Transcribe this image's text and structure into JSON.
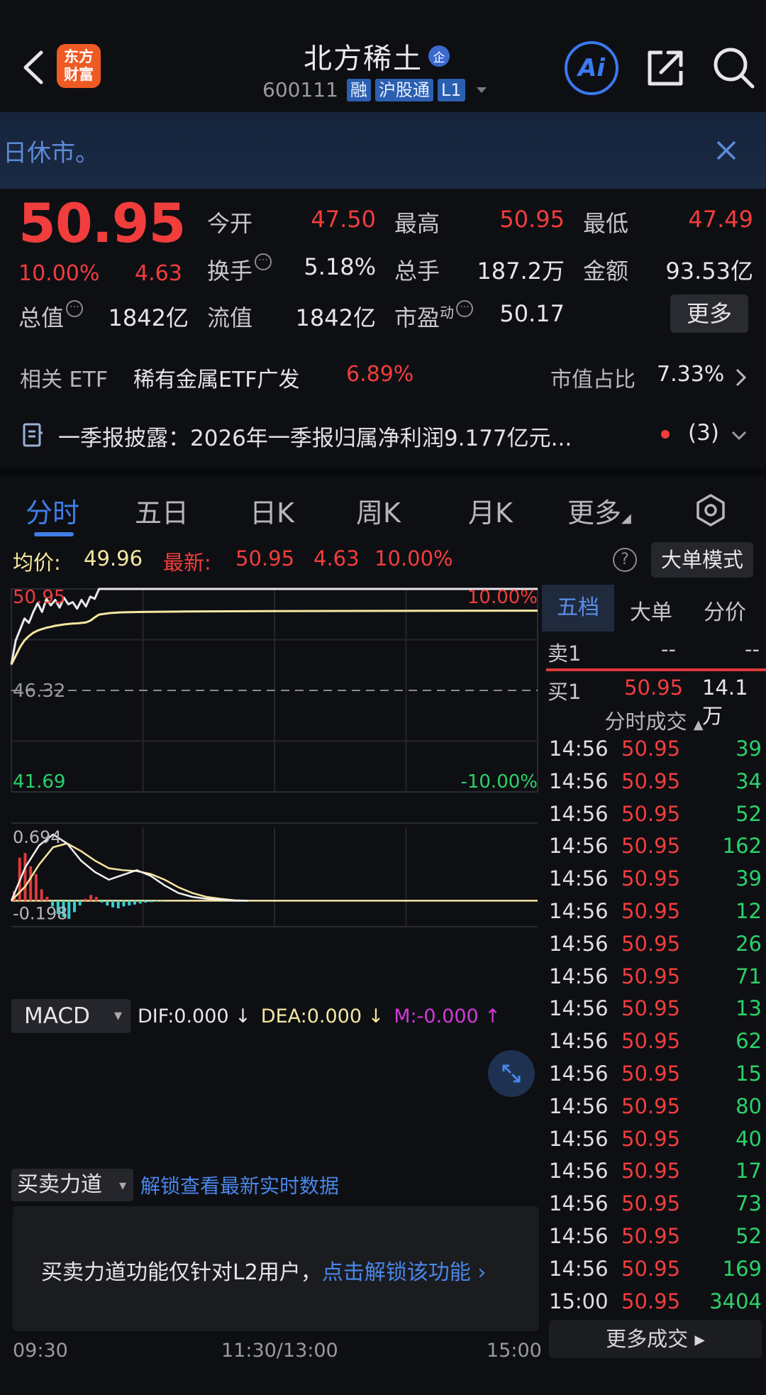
{
  "header": {
    "title": "北方稀土",
    "title_badge": "企",
    "logo_text_1": "东方",
    "logo_text_2": "财富",
    "code": "600111",
    "tags": [
      "融",
      "沪股通",
      "L1"
    ],
    "ai_label": "Ai",
    "icons": [
      "back-icon",
      "share-icon",
      "search-icon"
    ]
  },
  "notice": {
    "text": "日休市。"
  },
  "quote": {
    "price": "50.95",
    "pct": "10.00%",
    "change": "4.63",
    "stats": [
      {
        "label": "今开",
        "value": "47.50",
        "color": "#f23d3d"
      },
      {
        "label": "最高",
        "value": "50.95",
        "color": "#f23d3d"
      },
      {
        "label": "最低",
        "value": "47.49",
        "color": "#f23d3d"
      },
      {
        "label": "换手",
        "value": "5.18%",
        "color": "#e6e6ea"
      },
      {
        "label": "总手",
        "value": "187.2万",
        "color": "#e6e6ea"
      },
      {
        "label": "金额",
        "value": "93.53亿",
        "color": "#e6e6ea"
      },
      {
        "label": "总值",
        "value": "1842亿",
        "color": "#e6e6ea"
      },
      {
        "label": "流值",
        "value": "1842亿",
        "color": "#e6e6ea"
      },
      {
        "label": "市盈",
        "value": "50.17",
        "color": "#e6e6ea"
      }
    ],
    "pe_sup": "动",
    "more_label": "更多"
  },
  "etf": {
    "label": "相关 ETF",
    "name": "稀有金属ETF广发",
    "pct": "6.89%",
    "share_label": "市值占比",
    "share_value": "7.33%"
  },
  "report": {
    "text": "一季报披露：2026年一季报归属净利润9.177亿元...",
    "count": "(3)"
  },
  "tabs": [
    "分时",
    "五日",
    "日K",
    "周K",
    "月K",
    "更多"
  ],
  "avg_row": {
    "avg_label": "均价:",
    "avg_value": "49.96",
    "latest_label": "最新:",
    "latest_value": "50.95",
    "latest_change": "4.63",
    "latest_pct": "10.00%",
    "help": "?",
    "bigmode_label": "大单模式"
  },
  "chart_data": {
    "type": "line",
    "price_axis": {
      "top": "50.95",
      "mid": "46.32",
      "bottom": "41.69",
      "top_pct": "10.00%",
      "bottom_pct": "-10.00%"
    },
    "price_range": [
      41.69,
      50.95
    ],
    "prev_close": 46.32,
    "time_labels": [
      "09:30",
      "11:30/13:00",
      "15:00"
    ],
    "x_minutes": [
      0,
      2,
      4,
      6,
      8,
      10,
      12,
      14,
      16,
      18,
      20,
      22,
      24,
      26,
      28,
      30,
      32,
      34,
      36,
      38,
      40,
      45,
      50,
      60,
      80,
      120,
      180,
      240
    ],
    "series": [
      {
        "values": [
          47.5,
          48.6,
          49.1,
          49.6,
          49.4,
          49.9,
          50.3,
          49.9,
          50.5,
          50.2,
          50.45,
          50.1,
          50.55,
          50.25,
          50.35,
          50.05,
          50.45,
          50.15,
          50.6,
          50.5,
          50.95,
          50.95,
          50.95,
          50.95,
          50.95,
          50.95,
          50.95,
          50.95
        ],
        "color": "#e8e8ec"
      },
      {
        "values": [
          47.5,
          47.9,
          48.3,
          48.6,
          48.8,
          48.95,
          49.05,
          49.12,
          49.18,
          49.22,
          49.27,
          49.3,
          49.33,
          49.35,
          49.37,
          49.38,
          49.4,
          49.42,
          49.5,
          49.65,
          49.78,
          49.85,
          49.88,
          49.9,
          49.92,
          49.94,
          49.95,
          49.96
        ],
        "color": "#f5e7a0"
      }
    ],
    "macd": {
      "label": "MACD",
      "dif_label": "DIF:0.000 ↓",
      "dea_label": "DEA:0.000 ↓",
      "m_label": "M:-0.000 ↑",
      "y_top": "0.694",
      "y_bottom": "-0.198",
      "ylim": [
        -0.198,
        0.694
      ],
      "dif": [
        0.0,
        0.35,
        0.58,
        0.694,
        0.6,
        0.42,
        0.3,
        0.22,
        0.27,
        0.32,
        0.26,
        0.16,
        0.08,
        0.04,
        0.02,
        0.01,
        0.0,
        0.0
      ],
      "dea": [
        0.0,
        0.15,
        0.38,
        0.56,
        0.6,
        0.52,
        0.42,
        0.34,
        0.32,
        0.31,
        0.28,
        0.22,
        0.14,
        0.08,
        0.04,
        0.02,
        0.005,
        0.0
      ],
      "hist": [
        0.1,
        0.45,
        0.5,
        0.36,
        0.28,
        0.12,
        0.04,
        -0.06,
        -0.14,
        -0.17,
        -0.19,
        -0.12,
        -0.05,
        0.02,
        0.06,
        0.04,
        -0.02,
        -0.05,
        -0.07,
        -0.08,
        -0.06,
        -0.05,
        -0.04,
        -0.03,
        -0.02,
        -0.015,
        -0.01,
        -0.005,
        0.0
      ]
    }
  },
  "force": {
    "select_label": "买卖力道",
    "unlock_link": "解锁查看最新实时数据",
    "panel_text": "买卖力道功能仅针对L2用户，",
    "panel_link": "点击解锁该功能"
  },
  "orderbook": {
    "tabs": [
      "五档",
      "大单",
      "分价"
    ],
    "sell1": {
      "label": "卖1",
      "price": "--",
      "vol": "--"
    },
    "buy1": {
      "label": "买1",
      "price": "50.95",
      "vol": "14.1万"
    },
    "trades_head": "分时成交",
    "trades": [
      {
        "t": "14:56",
        "p": "50.95",
        "v": "39"
      },
      {
        "t": "14:56",
        "p": "50.95",
        "v": "34"
      },
      {
        "t": "14:56",
        "p": "50.95",
        "v": "52"
      },
      {
        "t": "14:56",
        "p": "50.95",
        "v": "162"
      },
      {
        "t": "14:56",
        "p": "50.95",
        "v": "39"
      },
      {
        "t": "14:56",
        "p": "50.95",
        "v": "12"
      },
      {
        "t": "14:56",
        "p": "50.95",
        "v": "26"
      },
      {
        "t": "14:56",
        "p": "50.95",
        "v": "71"
      },
      {
        "t": "14:56",
        "p": "50.95",
        "v": "13"
      },
      {
        "t": "14:56",
        "p": "50.95",
        "v": "62"
      },
      {
        "t": "14:56",
        "p": "50.95",
        "v": "15"
      },
      {
        "t": "14:56",
        "p": "50.95",
        "v": "80"
      },
      {
        "t": "14:56",
        "p": "50.95",
        "v": "40"
      },
      {
        "t": "14:56",
        "p": "50.95",
        "v": "17"
      },
      {
        "t": "14:56",
        "p": "50.95",
        "v": "73"
      },
      {
        "t": "14:56",
        "p": "50.95",
        "v": "52"
      },
      {
        "t": "14:56",
        "p": "50.95",
        "v": "169"
      },
      {
        "t": "15:00",
        "p": "50.95",
        "v": "3404"
      }
    ],
    "more_trades": "更多成交"
  }
}
